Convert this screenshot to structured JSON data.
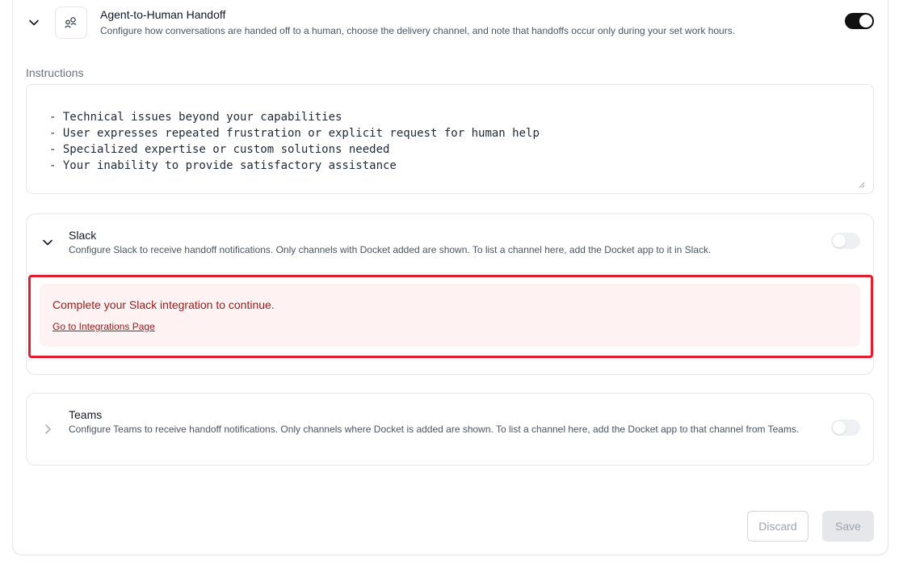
{
  "header": {
    "title": "Agent-to-Human Handoff",
    "description": "Configure how conversations are handed off to a human, choose the delivery channel, and note that handoffs occur only during your set work hours.",
    "icon": "handoff-users-icon",
    "enabled": true
  },
  "instructions": {
    "label": "Instructions",
    "lines": [
      "- Technical issues beyond your capabilities",
      "- User expresses repeated frustration or explicit request for human help",
      "- Specialized expertise or custom solutions needed",
      "- Your inability to provide satisfactory assistance"
    ]
  },
  "slack": {
    "title": "Slack",
    "description": "Configure Slack to receive handoff notifications. Only channels with Docket added are shown. To list a channel here, add the Docket app to it in Slack.",
    "enabled": false,
    "alert": {
      "message": "Complete your Slack integration to continue.",
      "link": "Go to Integrations Page"
    }
  },
  "teams": {
    "title": "Teams",
    "description": "Configure Teams to receive handoff notifications. Only channels where Docket is added are shown. To list a channel here, add the Docket app to that channel from Teams.",
    "enabled": false
  },
  "footer": {
    "discard_label": "Discard",
    "save_label": "Save"
  },
  "colors": {
    "toggle_on": "#111111",
    "alert_bg": "#fef2f2",
    "alert_text": "#991b1b",
    "highlight_outline": "#e11d2e"
  }
}
